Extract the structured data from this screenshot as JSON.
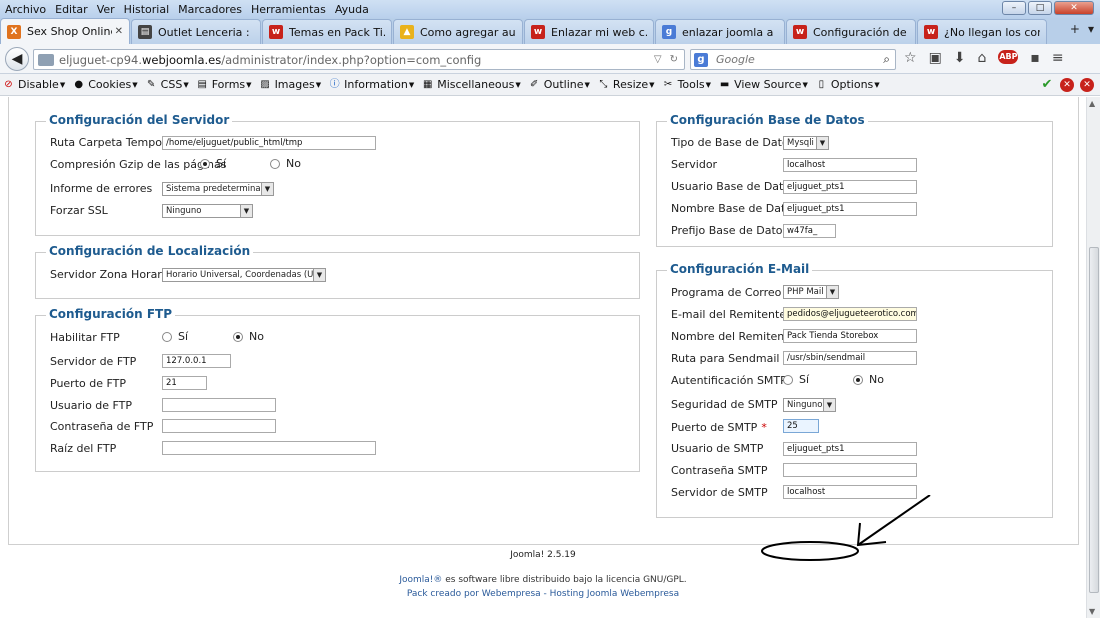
{
  "menu": [
    "Archivo",
    "Editar",
    "Ver",
    "Historial",
    "Marcadores",
    "Herramientas",
    "Ayuda"
  ],
  "tabs": [
    {
      "label": "Sex Shop Online. ...",
      "icon": "joomla-x-icon",
      "color": "#e0731f",
      "active": true
    },
    {
      "label": "Outlet Lenceria : ...",
      "icon": "page-icon",
      "color": "#444444",
      "active": false
    },
    {
      "label": "Temas en Pack Ti...",
      "icon": "webempresa-icon",
      "color": "#c7221b",
      "active": false
    },
    {
      "label": "Como agregar au...",
      "icon": "google-drive-icon",
      "color": "#e9b21b",
      "active": false
    },
    {
      "label": "Enlazar mi web c...",
      "icon": "webempresa-icon",
      "color": "#c7221b",
      "active": false
    },
    {
      "label": "enlazar joomla a ...",
      "icon": "google-g-icon",
      "color": "#4a7bd6",
      "active": false
    },
    {
      "label": "Configuración de ...",
      "icon": "webempresa-icon",
      "color": "#c7221b",
      "active": false
    },
    {
      "label": "¿No llegan los cor...",
      "icon": "webempresa-icon",
      "color": "#c7221b",
      "active": false
    }
  ],
  "url": {
    "prefix": "eljuguet-cp94.",
    "host": "webjoomla.es",
    "path": "/administrator/index.php?option=com_config"
  },
  "search": {
    "placeholder": "Google"
  },
  "devbar": [
    "Disable",
    "Cookies",
    "CSS",
    "Forms",
    "Images",
    "Information",
    "Miscellaneous",
    "Outline",
    "Resize",
    "Tools",
    "View Source",
    "Options"
  ],
  "server": {
    "legend": "Configuración del Servidor",
    "tmp_label": "Ruta Carpeta Temporal",
    "tmp_value": "/home/eljuguet/public_html/tmp",
    "gzip_label": "Compresión Gzip de las páginas",
    "yes": "Sí",
    "no": "No",
    "errors_label": "Informe de errores",
    "errors_value": "Sistema predeterminado",
    "ssl_label": "Forzar SSL",
    "ssl_value": "Ninguno"
  },
  "locale": {
    "legend": "Configuración de Localización",
    "tz_label": "Servidor Zona Horaria",
    "tz_value": "Horario Universal, Coordenadas (UTC)"
  },
  "ftp": {
    "legend": "Configuración FTP",
    "enable_label": "Habilitar FTP",
    "yes": "Sí",
    "no": "No",
    "host_label": "Servidor de FTP",
    "host_value": "127.0.0.1",
    "port_label": "Puerto de FTP",
    "port_value": "21",
    "user_label": "Usuario de FTP",
    "user_value": "",
    "pass_label": "Contraseña de FTP",
    "pass_value": "",
    "root_label": "Raíz del FTP",
    "root_value": ""
  },
  "db": {
    "legend": "Configuración Base de Datos",
    "type_label": "Tipo de Base de Datos",
    "type_value": "Mysqli",
    "host_label": "Servidor",
    "host_value": "localhost",
    "user_label": "Usuario Base de Datos",
    "user_value": "eljuguet_pts1",
    "name_label": "Nombre Base de Datos",
    "name_value": "eljuguet_pts1",
    "prefix_label": "Prefijo Base de Datos",
    "prefix_value": "w47fa_"
  },
  "mail": {
    "legend": "Configuración E-Mail",
    "mailer_label": "Programa de Correo",
    "mailer_value": "PHP Mail",
    "from_label": "E-mail del Remitente",
    "from_value": "pedidos@eljugueteerotico.com",
    "fromname_label": "Nombre del Remitente",
    "fromname_value": "Pack Tienda Storebox",
    "sendmail_label": "Ruta para Sendmail",
    "sendmail_value": "/usr/sbin/sendmail",
    "auth_label": "Autentificación SMTP",
    "yes": "Sí",
    "no": "No",
    "security_label": "Seguridad de SMTP",
    "security_value": "Ninguno",
    "port_label": "Puerto de SMTP",
    "port_value": "25",
    "user_label": "Usuario de SMTP",
    "user_value": "eljuguet_pts1",
    "pass_label": "Contraseña SMTP",
    "pass_value": "",
    "host_label": "Servidor de SMTP",
    "host_value": "localhost"
  },
  "footer": {
    "version": "Joomla! 2.5.19",
    "license_link": "Joomla!®",
    "license_text": " es software libre distribuido bajo la licencia GNU/GPL.",
    "pack_text": "Pack creado por Webempresa - Hosting Joomla Webempresa"
  },
  "colors": {
    "legend": "#1e5b8f",
    "required": "#cc0000",
    "link": "#2a5a9a"
  }
}
